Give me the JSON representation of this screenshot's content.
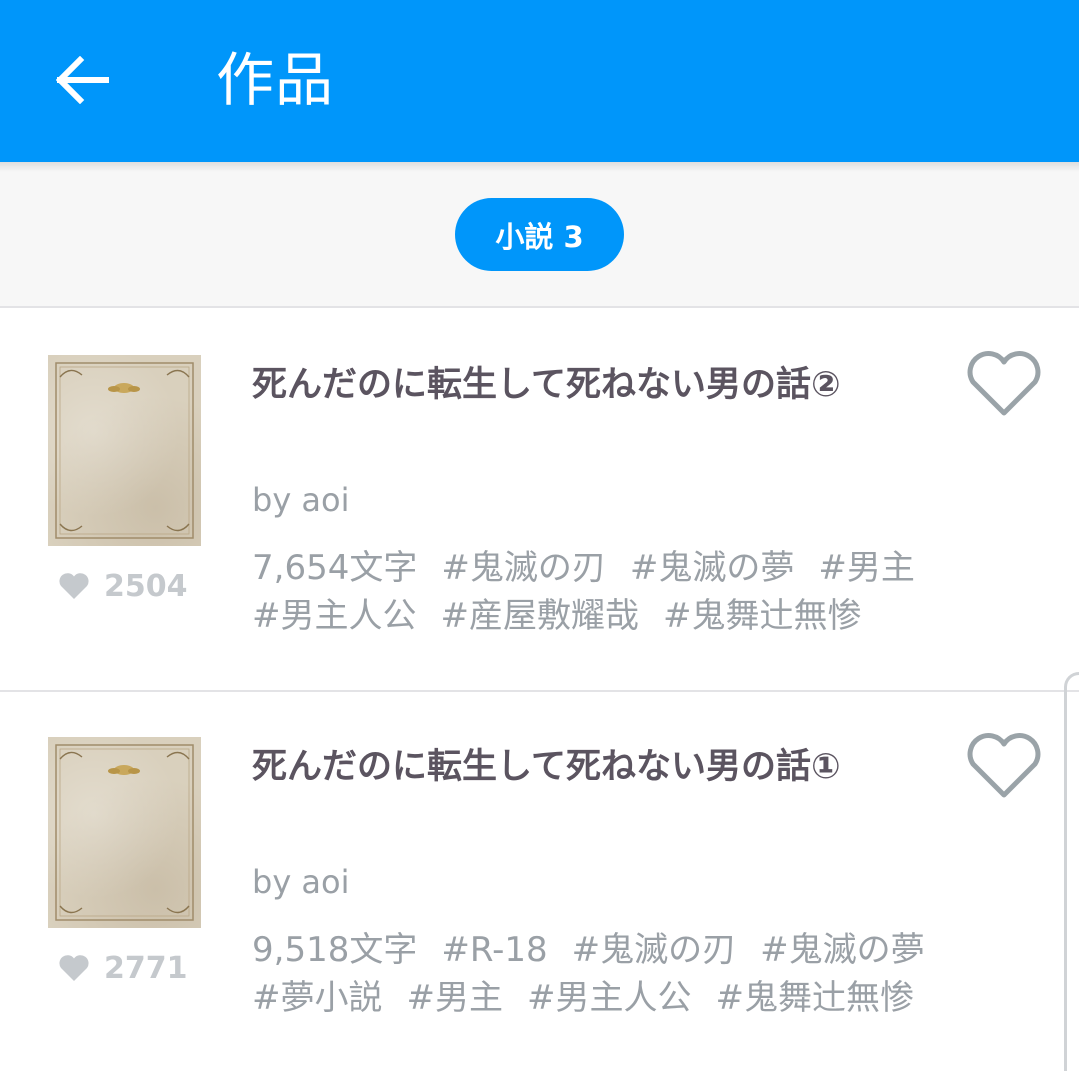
{
  "app_bar": {
    "title": "作品",
    "back_icon": "arrow-back-icon",
    "background": "#0096fa"
  },
  "filter": {
    "chip_label": "小説 3",
    "accent": "#0096fa"
  },
  "works": [
    {
      "title": "死んだのに転生して死ねない男の話②",
      "author": "by aoi",
      "char_count": "7,654文字",
      "tags": [
        "#鬼滅の刃",
        "#鬼滅の夢",
        "#男主",
        "#男主人公",
        "#産屋敷耀哉",
        "#鬼舞辻無惨"
      ],
      "likes": "2504",
      "like_icon": "heart-filled-icon",
      "bookmark_icon": "heart-outline-icon"
    },
    {
      "title": "死んだのに転生して死ねない男の話①",
      "author": "by aoi",
      "char_count": "9,518文字",
      "tags": [
        "#R-18",
        "#鬼滅の刃",
        "#鬼滅の夢",
        "#夢小説",
        "#男主",
        "#男主人公",
        "#鬼舞辻無惨"
      ],
      "likes": "2771",
      "like_icon": "heart-filled-icon",
      "bookmark_icon": "heart-outline-icon"
    }
  ]
}
